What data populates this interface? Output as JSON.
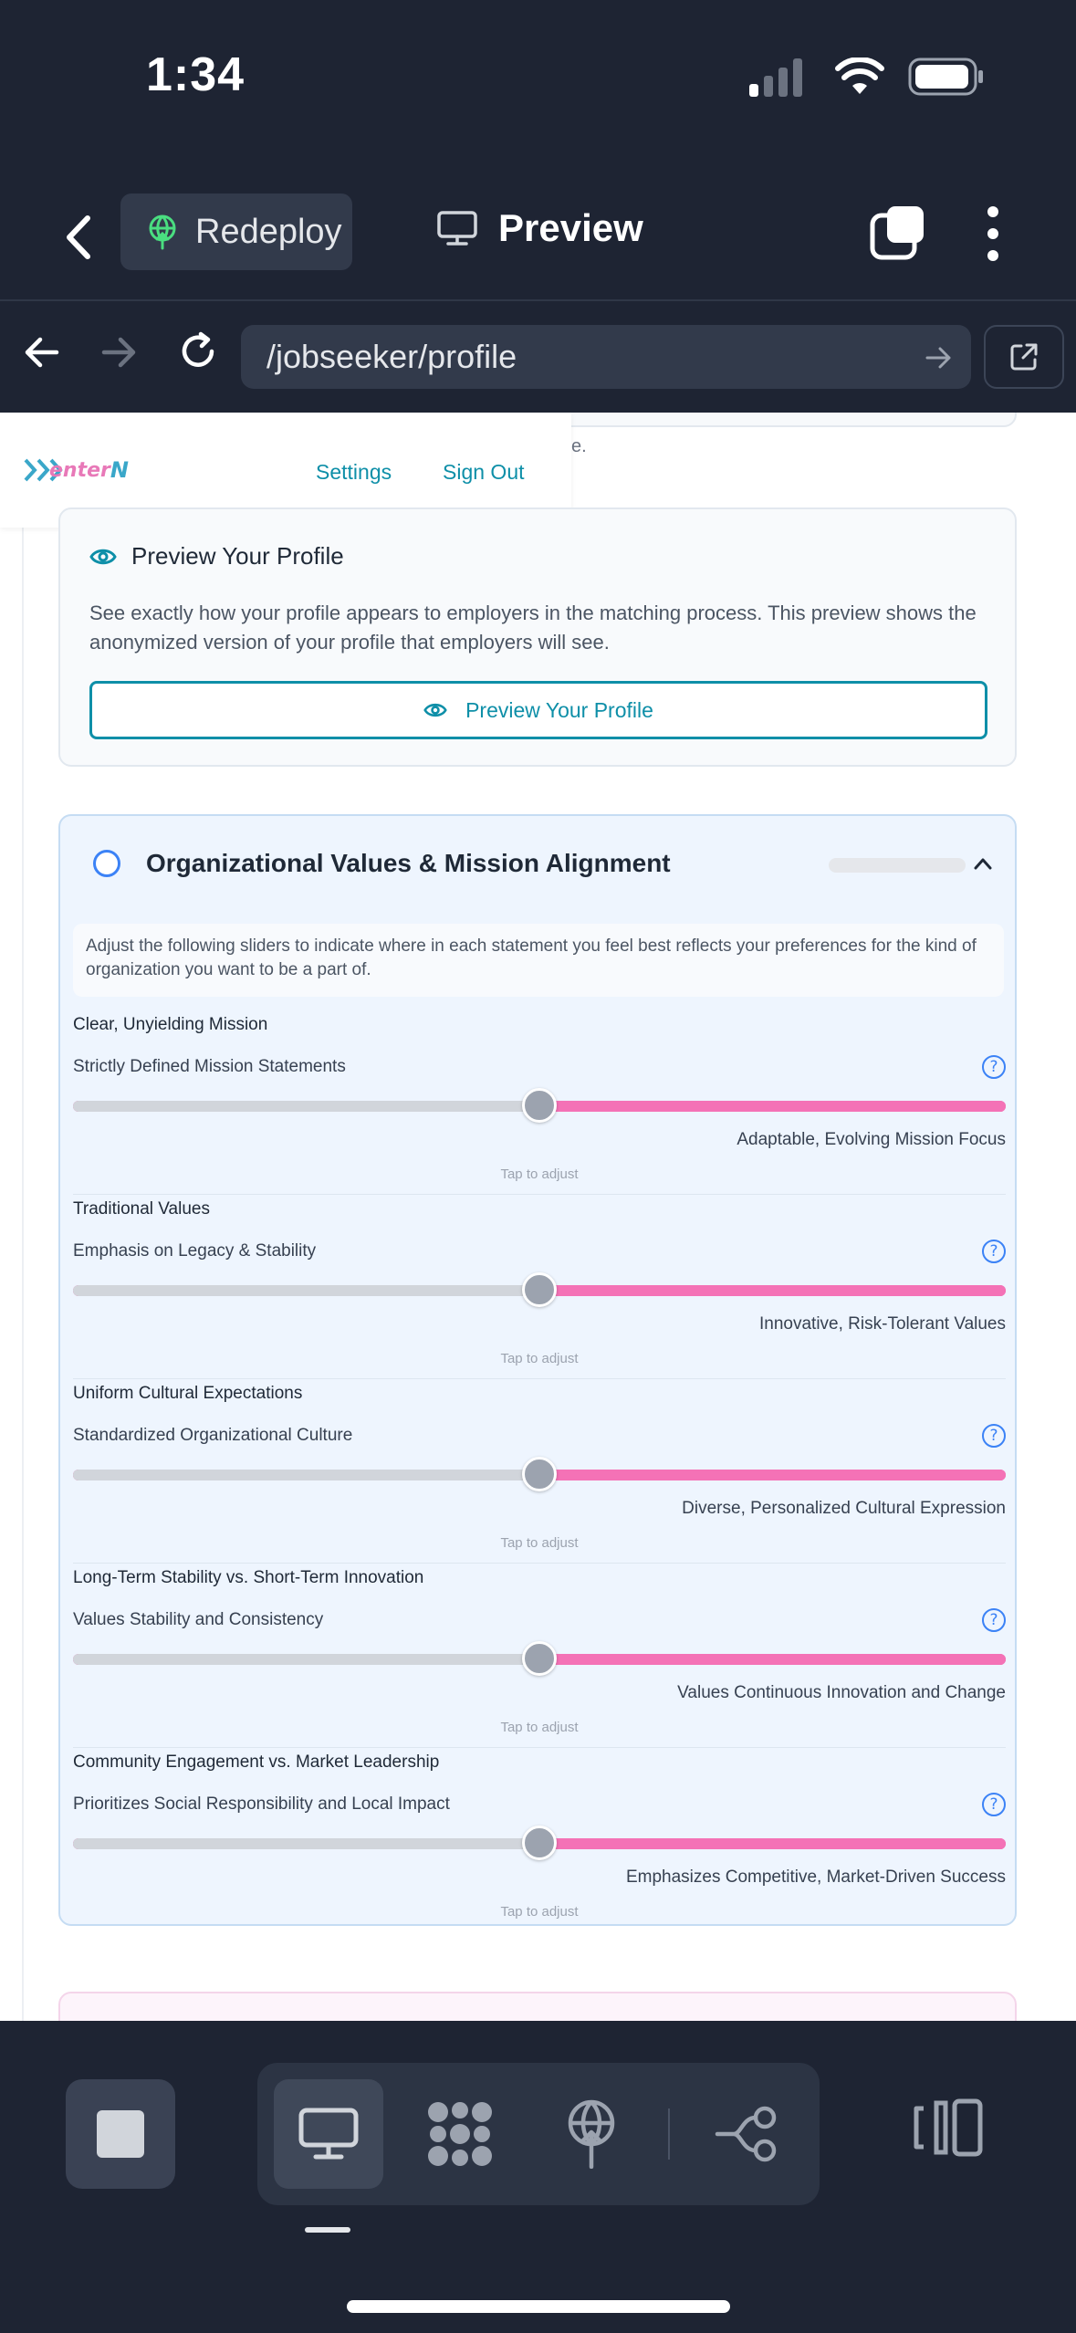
{
  "status_bar": {
    "time": "1:34"
  },
  "header": {
    "redeploy_label": "Redeploy",
    "preview_label": "Preview"
  },
  "browser": {
    "url": "/jobseeker/profile"
  },
  "site": {
    "logo_text": "enter",
    "logo_letter": "N",
    "nav": {
      "settings": "Settings",
      "sign_out": "Sign Out"
    },
    "remnant_text": "e."
  },
  "preview_card": {
    "title": "Preview Your Profile",
    "description": "See exactly how your profile appears to employers in the matching process. This preview shows the anonymized version of your profile that employers will see.",
    "button_label": "Preview Your Profile"
  },
  "values_section": {
    "title": "Organizational Values & Mission Alignment",
    "progress": 0,
    "intro": "Adjust the following sliders to indicate where in each statement you feel best reflects your preferences for the kind of organization you want to be a part of.",
    "tap_hint": "Tap to adjust",
    "sliders": [
      {
        "category": "Clear, Unyielding Mission",
        "left": "Strictly Defined Mission Statements",
        "right": "Adaptable, Evolving Mission Focus",
        "value": 0.5
      },
      {
        "category": "Traditional Values",
        "left": "Emphasis on Legacy & Stability",
        "right": "Innovative, Risk-Tolerant Values",
        "value": 0.5
      },
      {
        "category": "Uniform Cultural Expectations",
        "left": "Standardized Organizational Culture",
        "right": "Diverse, Personalized Cultural Expression",
        "value": 0.5
      },
      {
        "category": "Long-Term Stability vs. Short-Term Innovation",
        "left": "Values Stability and Consistency",
        "right": "Values Continuous Innovation and Change",
        "value": 0.5
      },
      {
        "category": "Community Engagement vs. Market Leadership",
        "left": "Prioritizes Social Responsibility and Local Impact",
        "right": "Emphasizes Competitive, Market-Driven Success",
        "value": 0.5
      }
    ]
  },
  "colors": {
    "accent_teal": "#0e8fa8",
    "slider_pink": "#f472b6",
    "slider_gray": "#d1d5db",
    "radio_blue": "#3b82f6",
    "chrome_dark": "#1e2433"
  },
  "icons": {
    "status": [
      "signal-icon",
      "wifi-icon",
      "battery-icon"
    ],
    "header": [
      "chevron-left-icon",
      "globe-upload-icon",
      "monitor-icon",
      "tabs-icon",
      "kebab-menu-icon"
    ],
    "browser": [
      "arrow-left-icon",
      "arrow-right-icon",
      "reload-icon",
      "arrow-go-icon",
      "external-link-icon"
    ],
    "toolbar": [
      "stop-icon",
      "monitor-icon",
      "grid-blob-icon",
      "deploy-globe-icon",
      "workflow-icon",
      "panel-toggle-icon"
    ]
  }
}
